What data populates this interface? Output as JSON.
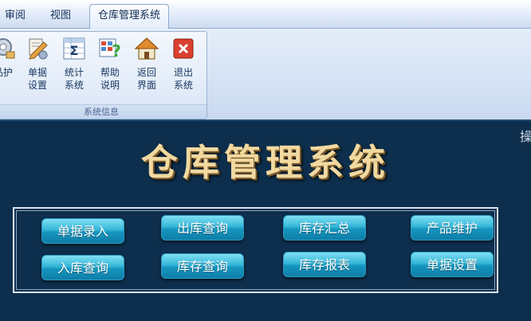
{
  "ribbon_tabs": [
    {
      "label": "审阅"
    },
    {
      "label": "视图"
    },
    {
      "label": "仓库管理系统"
    }
  ],
  "ribbon_group": {
    "caption": "系统信息",
    "buttons": [
      {
        "label": "品护",
        "icon": "product-icon"
      },
      {
        "label": "单据设置",
        "icon": "document-settings-icon"
      },
      {
        "label": "统计系统",
        "icon": "sigma-statistics-icon"
      },
      {
        "label": "帮助说明",
        "icon": "help-question-icon"
      },
      {
        "label": "返回界面",
        "icon": "home-icon"
      },
      {
        "label": "退出系统",
        "icon": "exit-x-icon"
      }
    ]
  },
  "side_text": "操",
  "main_title": "仓库管理系统",
  "menu_buttons": [
    {
      "label": "单据录入"
    },
    {
      "label": "出库查询"
    },
    {
      "label": "库存汇总"
    },
    {
      "label": "产品维护"
    },
    {
      "label": "入库查询"
    },
    {
      "label": "库存查询"
    },
    {
      "label": "库存报表"
    },
    {
      "label": "单据设置"
    }
  ],
  "colors": {
    "background_navy": "#0d2e4c",
    "title_gold": "#f1d9a0",
    "button_cyan": "#35b6d8"
  }
}
